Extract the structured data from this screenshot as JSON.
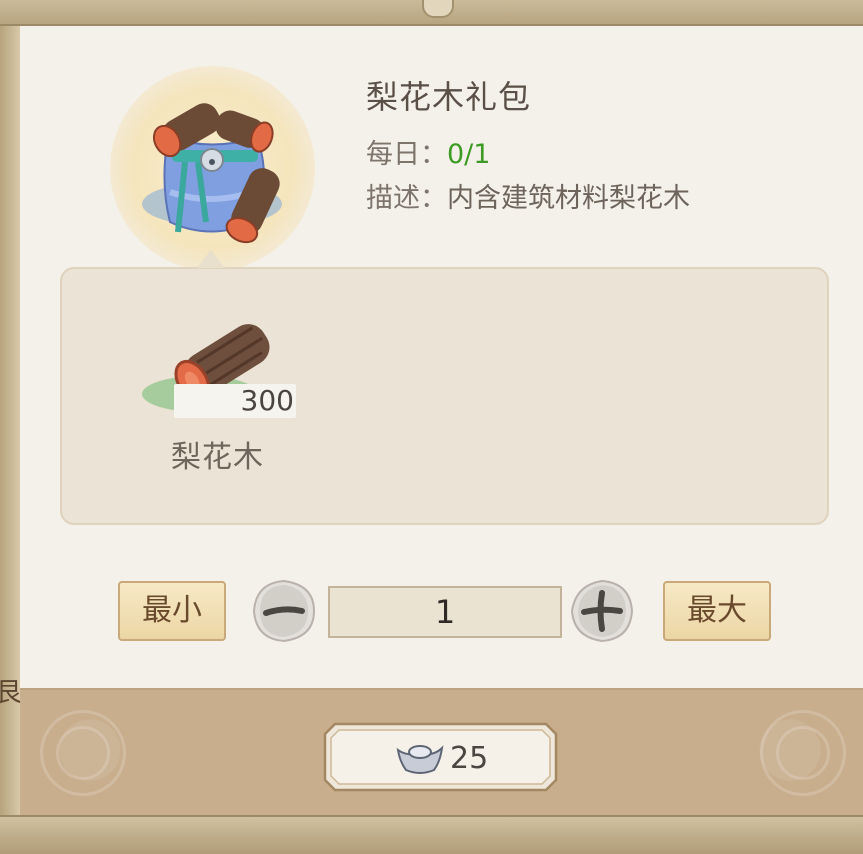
{
  "item": {
    "title": "梨花木礼包",
    "daily_label": "每日：",
    "daily_value": "0/1",
    "desc_label": "描述：",
    "desc_value": "内含建筑材料梨花木",
    "icon": "gift-bag-with-wood-logs-icon"
  },
  "contents": [
    {
      "name": "梨花木",
      "quantity": "300",
      "icon": "wood-log-icon"
    }
  ],
  "quantity_controls": {
    "min_label": "最小",
    "max_label": "最大",
    "value": "1",
    "decrement_icon": "minus-icon",
    "increment_icon": "plus-icon"
  },
  "purchase": {
    "price": "25",
    "currency_icon": "silver-ingot-icon"
  },
  "side_glyph": "艮",
  "colors": {
    "daily_value": "#3d9a24",
    "panel": "#f4f1ea",
    "contents_bg": "#ebe3d5",
    "button_bg": "#f2e0b4",
    "bottom_band": "#c8ae8d"
  }
}
